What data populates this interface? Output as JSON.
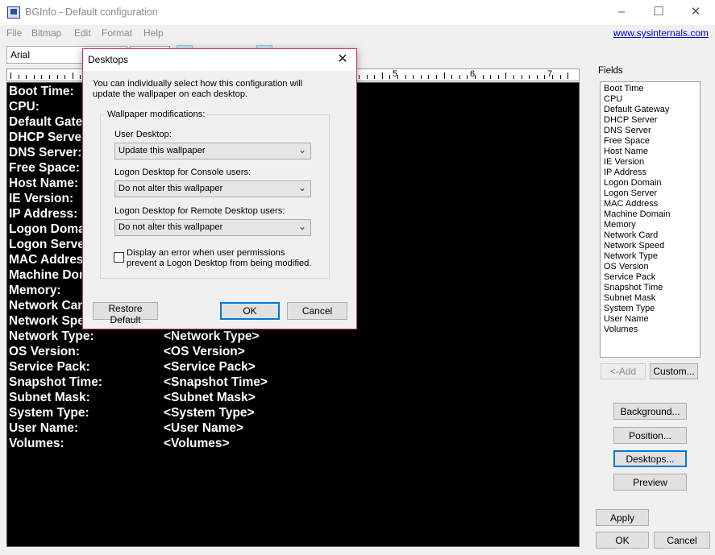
{
  "window": {
    "title": "BGInfo - Default configuration",
    "controls": {
      "minimize": "–",
      "maximize": "☐",
      "close": "✕"
    }
  },
  "menu": {
    "items": [
      "File",
      "Bitmap",
      "Edit",
      "Format",
      "Help"
    ],
    "link": "www.sysinternals.com"
  },
  "toolbar": {
    "font": "Arial",
    "size": ""
  },
  "ruler": {
    "numbers": [
      "5",
      "6",
      "7"
    ]
  },
  "editor": {
    "lines": [
      {
        "label": "Boot Time:",
        "value": ""
      },
      {
        "label": "CPU:",
        "value": ""
      },
      {
        "label": "Default Gateway:",
        "value": ""
      },
      {
        "label": "DHCP Server:",
        "value": ""
      },
      {
        "label": "DNS Server:",
        "value": ""
      },
      {
        "label": "Free Space:",
        "value": ""
      },
      {
        "label": "Host Name:",
        "value": ""
      },
      {
        "label": "IE Version:",
        "value": ""
      },
      {
        "label": "IP Address:",
        "value": ""
      },
      {
        "label": "Logon Domain:",
        "value": ""
      },
      {
        "label": "Logon Server:",
        "value": ""
      },
      {
        "label": "MAC Address:",
        "value": ""
      },
      {
        "label": "Machine Domain:",
        "value": ""
      },
      {
        "label": "Memory:",
        "value": ""
      },
      {
        "label": "Network Card:",
        "value": ""
      },
      {
        "label": "Network Speed:",
        "value": ""
      },
      {
        "label": "Network Type:",
        "value": "<Network Type>"
      },
      {
        "label": "OS Version:",
        "value": "<OS Version>"
      },
      {
        "label": "Service Pack:",
        "value": "<Service Pack>"
      },
      {
        "label": "Snapshot Time:",
        "value": "<Snapshot Time>"
      },
      {
        "label": "Subnet Mask:",
        "value": "<Subnet Mask>"
      },
      {
        "label": "System Type:",
        "value": "<System Type>"
      },
      {
        "label": "User Name:",
        "value": "<User Name>"
      },
      {
        "label": "Volumes:",
        "value": "<Volumes>"
      }
    ]
  },
  "fields": {
    "caption": "Fields",
    "items": [
      "Boot Time",
      "CPU",
      "Default Gateway",
      "DHCP Server",
      "DNS Server",
      "Free Space",
      "Host Name",
      "IE Version",
      "IP Address",
      "Logon Domain",
      "Logon Server",
      "MAC Address",
      "Machine Domain",
      "Memory",
      "Network Card",
      "Network Speed",
      "Network Type",
      "OS Version",
      "Service Pack",
      "Snapshot Time",
      "Subnet Mask",
      "System Type",
      "User Name",
      "Volumes"
    ],
    "add_label": "<-Add",
    "custom_label": "Custom..."
  },
  "side_buttons": {
    "background": "Background...",
    "position": "Position...",
    "desktops": "Desktops...",
    "preview": "Preview",
    "apply": "Apply",
    "ok": "OK",
    "cancel": "Cancel"
  },
  "dialog": {
    "title": "Desktops",
    "close": "✕",
    "description": "You can individually select how this configuration will update the wallpaper on each desktop.",
    "group_caption": "Wallpaper modifications:",
    "user_desktop_label": "User Desktop:",
    "user_desktop_value": "Update this wallpaper",
    "console_label": "Logon Desktop for Console users:",
    "console_value": "Do not alter this wallpaper",
    "remote_label": "Logon Desktop for Remote Desktop users:",
    "remote_value": "Do not alter this wallpaper",
    "checkbox_text": "Display an error when user permissions prevent a Logon Desktop from being modified.",
    "checkbox_checked": false,
    "restore_label": "Restore Default",
    "ok_label": "OK",
    "cancel_label": "Cancel"
  },
  "colors": {
    "editor_bg": "#000000",
    "editor_text": "#ffffff",
    "dialog_border": "#c8326e",
    "focus": "#0078d7",
    "link": "#0000cc"
  }
}
